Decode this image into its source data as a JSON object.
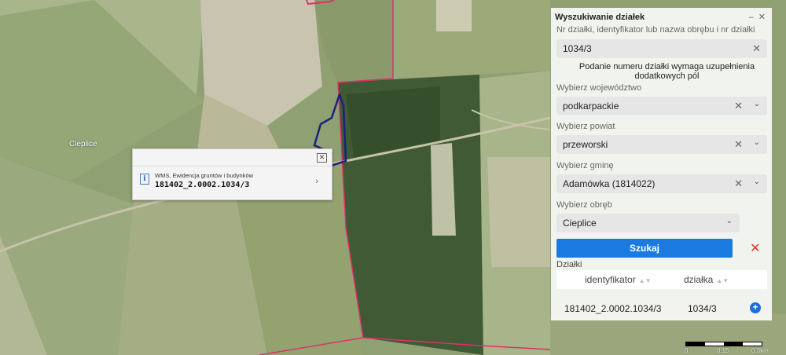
{
  "map": {
    "place_label": "Cieplice",
    "colors": {
      "parcel_boundary": "#e0306a",
      "selected_parcel": "#1a237e"
    }
  },
  "popup": {
    "source": "WMS, Ewidencja gruntów i budynków",
    "parcel_id": "181402_2.0002.1034/3",
    "close_icon": "close-icon",
    "chevron_icon": "chevron-right-icon"
  },
  "panel": {
    "title": "Wyszukiwanie działek",
    "search_label": "Nr działki, identyfikator lub nazwa obrębu i nr działki",
    "search_value": "1034/3",
    "note": "Podanie numeru działki wymaga uzupełnienia dodatkowych pól",
    "voivodeship_label": "Wybierz województwo",
    "voivodeship_value": "podkarpackie",
    "county_label": "Wybierz powiat",
    "county_value": "przeworski",
    "commune_label": "Wybierz gminę",
    "commune_value": "Adamówka (1814022)",
    "precinct_label": "Wybierz obręb",
    "precinct_value": "Cieplice",
    "search_button": "Szukaj",
    "results_label": "Działki",
    "table": {
      "columns": [
        "identyfikator",
        "działka"
      ],
      "rows": [
        {
          "identyfikator": "181402_2.0002.1034/3",
          "dzialka": "1034/3"
        }
      ]
    },
    "colors": {
      "accent": "#1a7ae0",
      "clear": "#d9382c"
    }
  },
  "scale": {
    "ticks": [
      "0",
      "0.15",
      "0.3km"
    ]
  }
}
